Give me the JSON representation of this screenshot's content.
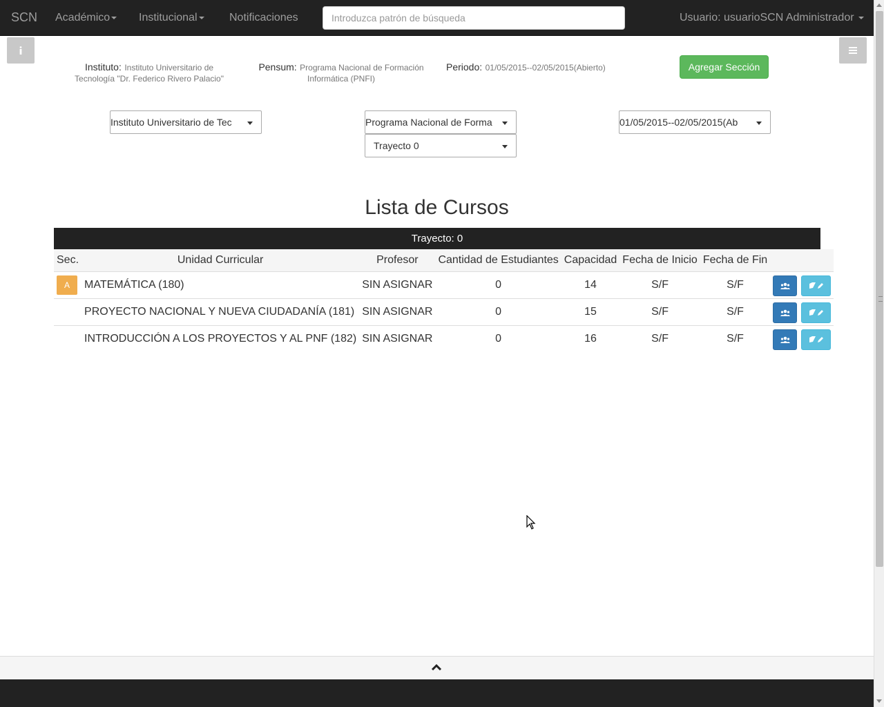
{
  "navbar": {
    "brand": "SCN",
    "menu": [
      "Académico",
      "Institucional",
      "Notificaciones"
    ],
    "search_placeholder": "Introduzca patrón de búsqueda",
    "user_label": "Usuario: usuarioSCN Administrador"
  },
  "info": {
    "instituto_label": "Instituto:",
    "instituto_value": "Instituto Universitario de Tecnología \"Dr. Federico Rivero Palacio\"",
    "pensum_label": "Pensum:",
    "pensum_value": "Programa Nacional de Formación Informática (PNFI)",
    "periodo_label": "Periodo:",
    "periodo_value": "01/05/2015--02/05/2015(Abierto)"
  },
  "actions": {
    "add_section": "Agregar Sección"
  },
  "filters": {
    "instituto": "Instituto Universitario de Tec",
    "programa": "Programa Nacional de Forma",
    "periodo": "01/05/2015--02/05/2015(Ab",
    "trayecto": "Trayecto 0"
  },
  "list": {
    "title": "Lista de Cursos",
    "caption": "Trayecto: 0",
    "headers": [
      "Sec.",
      "Unidad Curricular",
      "Profesor",
      "Cantidad de Estudiantes",
      "Capacidad",
      "Fecha de Inicio",
      "Fecha de Fin"
    ],
    "rows": [
      {
        "sec": "A",
        "unidad": "MATEMÁTICA (180)",
        "profesor": "SIN ASIGNAR",
        "estudiantes": "0",
        "capacidad": "14",
        "inicio": "S/F",
        "fin": "S/F"
      },
      {
        "sec": "",
        "unidad": "PROYECTO NACIONAL Y NUEVA CIUDADANÍA (181)",
        "profesor": "SIN ASIGNAR",
        "estudiantes": "0",
        "capacidad": "15",
        "inicio": "S/F",
        "fin": "S/F"
      },
      {
        "sec": "",
        "unidad": "INTRODUCCIÓN A LOS PROYECTOS Y AL PNF (182)",
        "profesor": "SIN ASIGNAR",
        "estudiantes": "0",
        "capacidad": "16",
        "inicio": "S/F",
        "fin": "S/F"
      }
    ]
  },
  "icons": {
    "info": "info-icon",
    "menu": "hamburger-icon",
    "students": "group-icon",
    "edit": "book-pencil-icon",
    "collapse": "chevron-up-icon"
  },
  "colors": {
    "navbar_bg": "#222222",
    "success": "#5cb85c",
    "primary": "#337ab7",
    "info": "#5bc0de",
    "warning": "#f0ad4e"
  }
}
